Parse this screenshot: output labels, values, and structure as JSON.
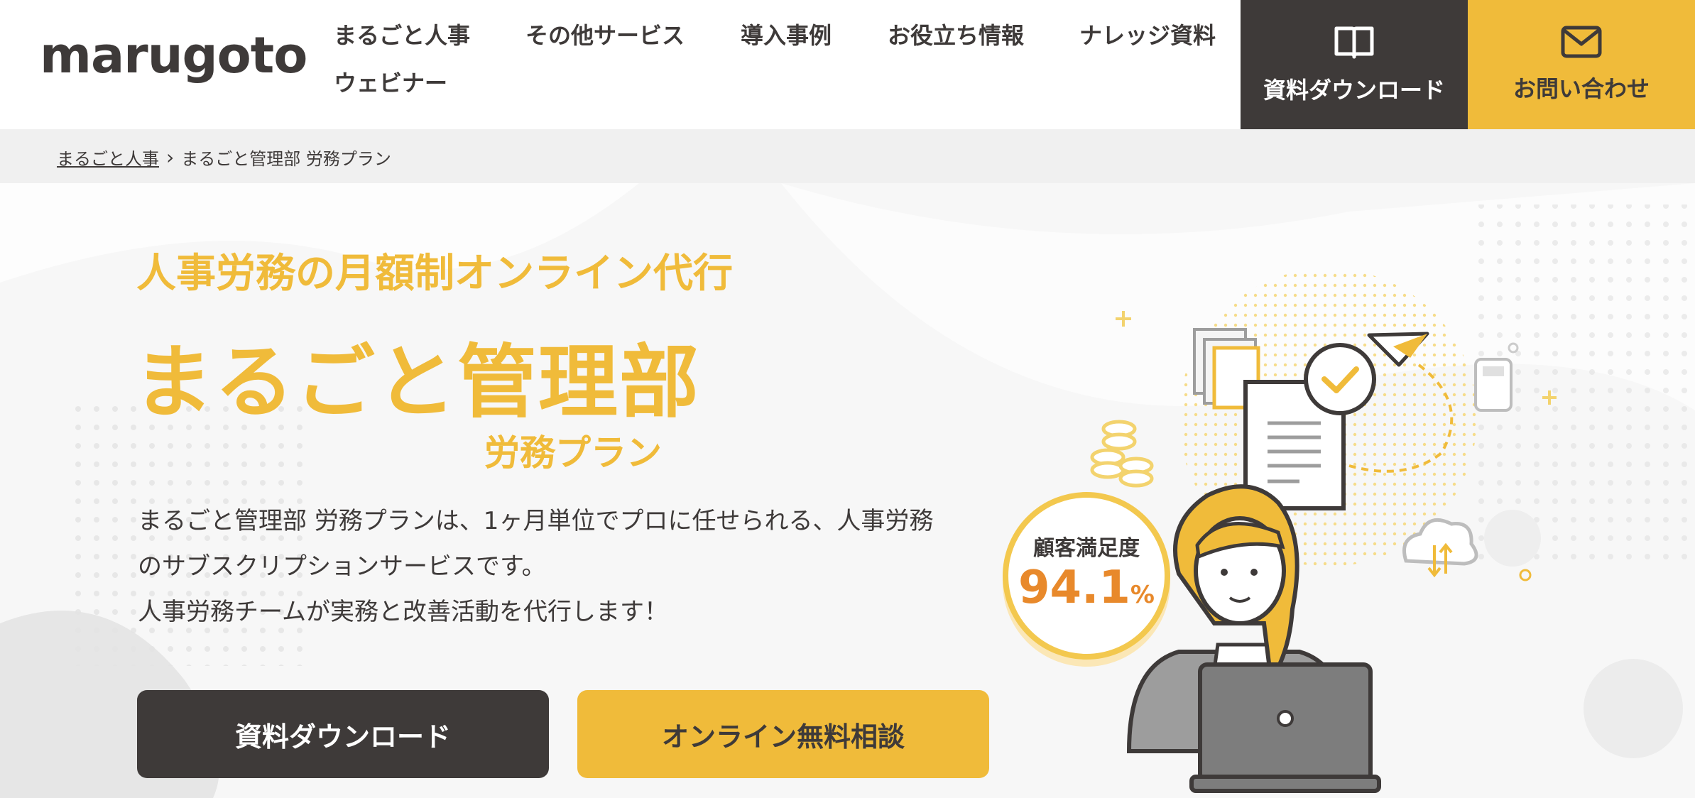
{
  "header": {
    "logo": "marugoto",
    "nav": [
      "まるごと人事",
      "その他サービス",
      "導入事例",
      "お役立ち情報",
      "ナレッジ資料",
      "ウェビナー"
    ],
    "download_label": "資料ダウンロード",
    "contact_label": "お問い合わせ"
  },
  "breadcrumb": {
    "home": "まるごと人事",
    "separator": "›",
    "current": "まるごと管理部 労務プラン"
  },
  "hero": {
    "subtitle": "人事労務の月額制オンライン代行",
    "title": "まるごと管理部",
    "plan": "労務プラン",
    "description_line1": "まるごと管理部 労務プランは、1ヶ月単位でプロに任せられる、人事労務",
    "description_line2": "のサブスクリプションサービスです。",
    "description_line3": "人事労務チームが実務と改善活動を代行します！",
    "download_button": "資料ダウンロード",
    "consult_button": "オンライン無料相談",
    "badge_label": "顧客満足度",
    "badge_value": "94.1",
    "badge_unit": "%"
  },
  "colors": {
    "accent": "#f0bb3a",
    "dark": "#3e3a39",
    "highlight": "#e8892b"
  },
  "icons": [
    "book-icon",
    "mail-icon",
    "chevron-right-icon"
  ]
}
